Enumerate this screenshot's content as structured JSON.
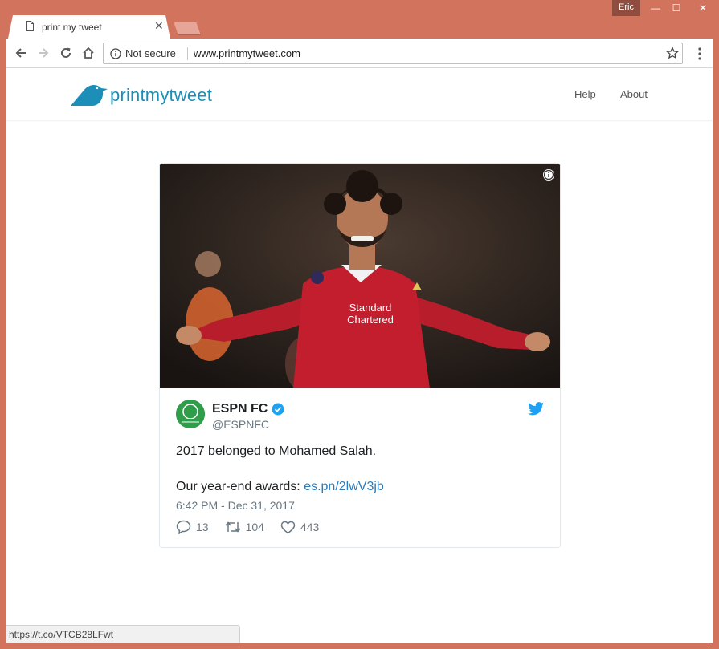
{
  "window": {
    "user_name": "Eric",
    "minimize_glyph": "—",
    "maximize_glyph": "☐",
    "close_glyph": "✕"
  },
  "tabs": [
    {
      "title": "print my tweet",
      "icon": "page-icon",
      "close_glyph": "✕"
    }
  ],
  "toolbar": {
    "security_label": "Not secure",
    "url": "www.printmytweet.com"
  },
  "site": {
    "logo_text": "printmytweet",
    "brand_color": "#1b8fb8",
    "nav": [
      {
        "label": "Help"
      },
      {
        "label": "About"
      }
    ]
  },
  "tweet": {
    "author_name": "ESPN FC",
    "author_handle": "@ESPNFC",
    "text_line1": "2017 belonged to Mohamed Salah.",
    "text_line2_prefix": "Our year-end awards: ",
    "text_link": "es.pn/2lwV3jb",
    "timestamp": "6:42 PM - Dec 31, 2017",
    "jersey_line1": "Standard",
    "jersey_line2": "Chartered",
    "replies": "13",
    "retweets": "104",
    "likes": "443",
    "link_color": "#2b7bb9",
    "twitter_color": "#1da1f2"
  },
  "status_bar": {
    "text": "https://t.co/VTCB28LFwt"
  }
}
